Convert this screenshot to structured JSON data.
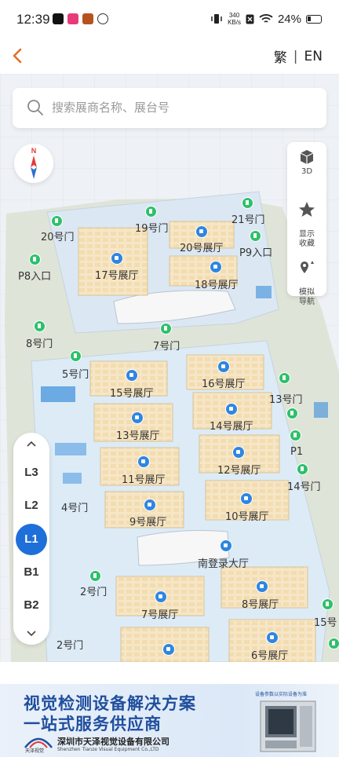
{
  "status_bar": {
    "time": "12:39",
    "net_speed_value": "340",
    "net_speed_unit": "KB/s",
    "battery": "24%"
  },
  "header": {
    "lang_traditional": "繁",
    "lang_separator": "|",
    "lang_english": "EN"
  },
  "search": {
    "placeholder": "搜索展商名称、展台号"
  },
  "compass": {
    "north": "N"
  },
  "tools": {
    "three_d": "3D",
    "show_favorites": "显示\n收藏",
    "simulate_nav": "模拟\n导航"
  },
  "floors": [
    "L3",
    "L2",
    "L1",
    "B1",
    "B2"
  ],
  "active_floor": "L1",
  "map": {
    "halls": [
      "20号展厅",
      "17号展厅",
      "18号展厅",
      "16号展厅",
      "15号展厅",
      "14号展厅",
      "13号展厅",
      "12号展厅",
      "11号展厅",
      "10号展厅",
      "9号展厅",
      "8号展厅",
      "7号展厅",
      "6号展厅"
    ],
    "gates": [
      "19号门",
      "21号门",
      "20号门",
      "P9入口",
      "P8入口",
      "8号门",
      "7号门",
      "5号门",
      "13号门",
      "P1",
      "14号门",
      "4号门",
      "2号门",
      "15号",
      "2号门"
    ],
    "lobby": "南登录大厅"
  },
  "ad": {
    "headline1": "视觉检测设备解决方案",
    "headline2": "一站式服务供应商",
    "company_cn": "深圳市天泽视觉设备有限公司",
    "company_en": "Shenzhen Tianze Visual Equipment Co.,LTD",
    "logo_text": "天泽视觉",
    "note": "设备参数以实际设备为准"
  },
  "colors": {
    "accent": "#1e6fd9",
    "back_arrow": "#e0702a",
    "gate_green": "#2ec06a",
    "hall_blue": "#2f86e0",
    "ad_blue": "#1f4e9c"
  }
}
